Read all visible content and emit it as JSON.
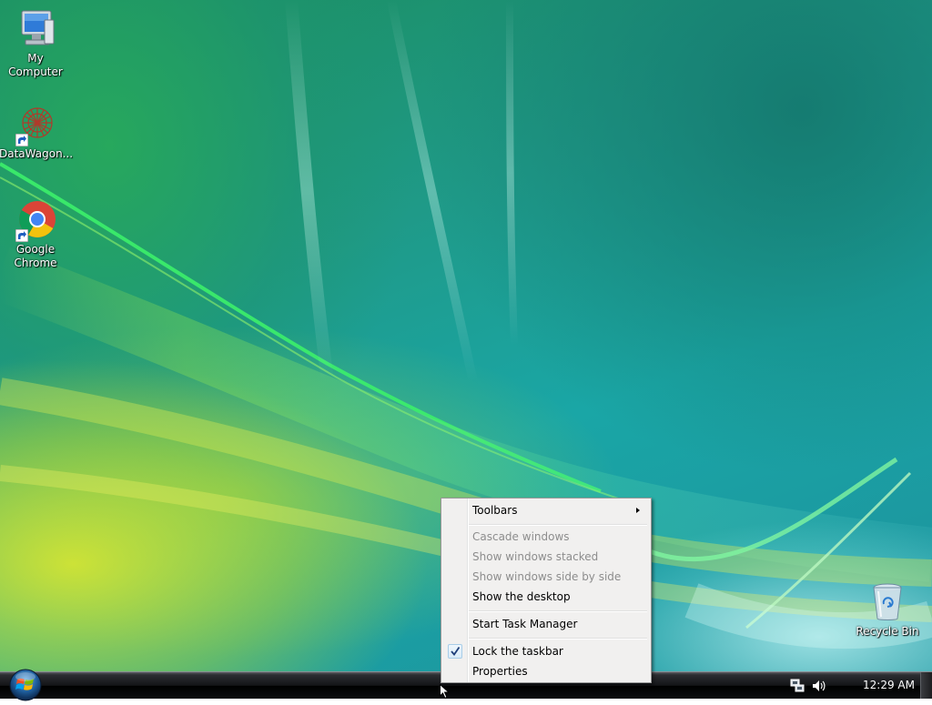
{
  "desktop": {
    "icons": [
      {
        "label": "My Computer",
        "icon": "my-computer-icon"
      },
      {
        "label": "DataWagon...",
        "icon": "datawagon-icon"
      },
      {
        "label_line1": "Google",
        "label_line2": "Chrome",
        "icon": "google-chrome-icon"
      },
      {
        "label": "Recycle Bin",
        "icon": "recycle-bin-icon"
      }
    ]
  },
  "context_menu": {
    "items": [
      {
        "label": "Toolbars",
        "enabled": true,
        "has_submenu": true
      },
      {
        "label": "Cascade windows",
        "enabled": false
      },
      {
        "label": "Show windows stacked",
        "enabled": false
      },
      {
        "label": "Show windows side by side",
        "enabled": false
      },
      {
        "label": "Show the desktop",
        "enabled": true
      },
      {
        "label": "Start Task Manager",
        "enabled": true
      },
      {
        "label": "Lock the taskbar",
        "enabled": true,
        "checked": true
      },
      {
        "label": "Properties",
        "enabled": true
      }
    ]
  },
  "taskbar": {
    "start_button": "windows-start-orb-icon",
    "tray": {
      "icons": [
        "network-icon",
        "volume-icon"
      ],
      "clock": "12:29 AM"
    }
  },
  "colors": {
    "menu_background": "#f1f0ef",
    "disabled_text": "#8d8d8d",
    "taskbar": "#141518"
  }
}
